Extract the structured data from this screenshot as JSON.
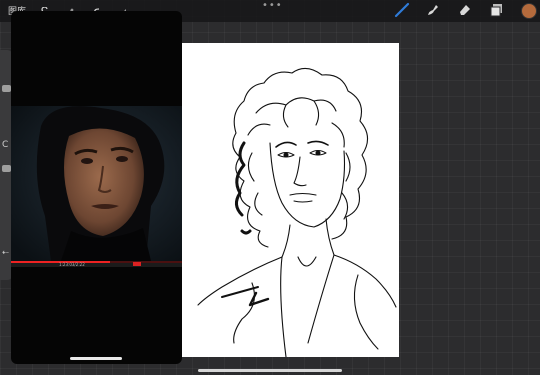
{
  "topbar": {
    "gallery_label": "图库",
    "tool_icons": [
      "wrench-icon",
      "magic-wand-icon",
      "selection-icon",
      "transform-arrow-icon"
    ],
    "right_tools": [
      "brush-icon",
      "smudge-icon",
      "eraser-icon",
      "layers-icon"
    ],
    "more_label": "•••",
    "active_color": "#b46a3c",
    "active_tool_color": "#2f7bd8"
  },
  "sidebar": {
    "label": "C"
  },
  "video": {
    "time_text": "1:23:03/2:22",
    "progress_fraction": 0.58
  }
}
